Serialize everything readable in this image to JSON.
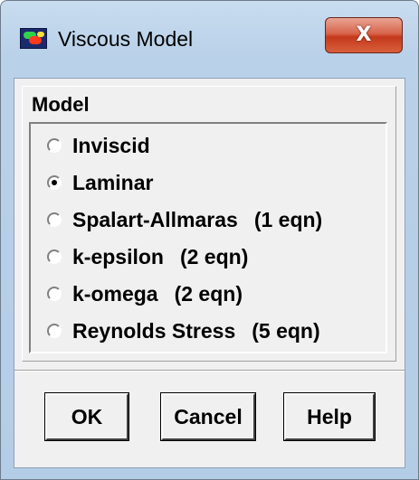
{
  "window": {
    "title": "Viscous Model",
    "close_label": "X"
  },
  "icons": {
    "app": "fluent-app-icon",
    "close": "close-icon"
  },
  "model_group": {
    "title": "Model",
    "options": [
      {
        "label": "Inviscid",
        "eqn": "",
        "checked": false
      },
      {
        "label": "Laminar",
        "eqn": "",
        "checked": true
      },
      {
        "label": "Spalart-Allmaras",
        "eqn": "(1 eqn)",
        "checked": false
      },
      {
        "label": "k-epsilon",
        "eqn": "(2 eqn)",
        "checked": false
      },
      {
        "label": "k-omega",
        "eqn": "(2 eqn)",
        "checked": false
      },
      {
        "label": "Reynolds Stress",
        "eqn": "(5 eqn)",
        "checked": false
      }
    ]
  },
  "buttons": {
    "ok": "OK",
    "cancel": "Cancel",
    "help": "Help"
  },
  "colors": {
    "close_button": "#c4391c",
    "titlebar": "#b9d1e9",
    "client": "#f0f0f0"
  }
}
